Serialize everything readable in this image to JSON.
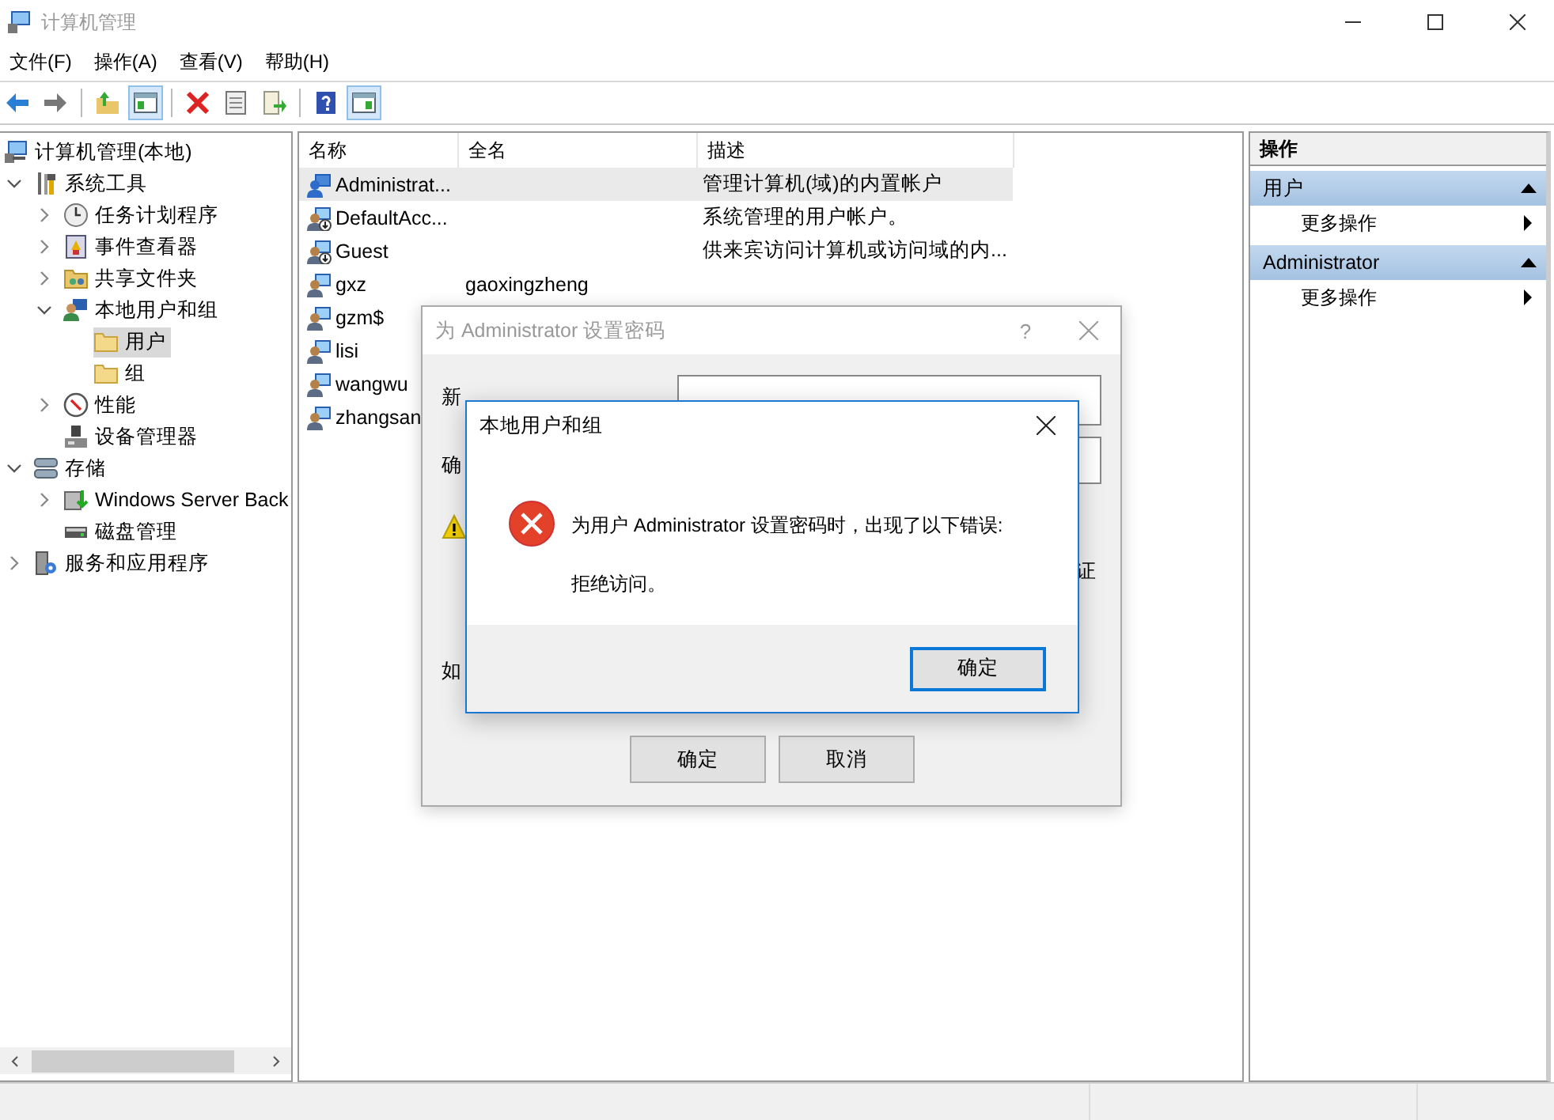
{
  "window": {
    "title": "计算机管理"
  },
  "menu": [
    "文件(F)",
    "操作(A)",
    "查看(V)",
    "帮助(H)"
  ],
  "toolbar": [
    [
      {
        "kind": "back",
        "selected": false
      },
      {
        "kind": "forward",
        "selected": false
      }
    ],
    [
      {
        "kind": "up",
        "selected": false
      },
      {
        "kind": "tree-pane",
        "selected": true
      }
    ],
    [
      {
        "kind": "delete",
        "selected": false
      },
      {
        "kind": "properties",
        "selected": false
      },
      {
        "kind": "export",
        "selected": false
      }
    ],
    [
      {
        "kind": "help",
        "selected": false
      },
      {
        "kind": "action-pane",
        "selected": true
      }
    ]
  ],
  "tree": {
    "label": "计算机管理(本地)",
    "kind": "computer",
    "selected": false,
    "children": [
      {
        "label": "系统工具",
        "kind": "tools",
        "expanded": true,
        "selected": false,
        "children": [
          {
            "label": "任务计划程序",
            "kind": "clock",
            "expanded": false,
            "selected": false
          },
          {
            "label": "事件查看器",
            "kind": "event",
            "expanded": false,
            "selected": false
          },
          {
            "label": "共享文件夹",
            "kind": "share",
            "expanded": false,
            "selected": false
          },
          {
            "label": "本地用户和组",
            "kind": "users",
            "expanded": true,
            "selected": false,
            "children": [
              {
                "label": "用户",
                "kind": "folder",
                "selected": true
              },
              {
                "label": "组",
                "kind": "folder",
                "selected": false
              }
            ]
          },
          {
            "label": "性能",
            "kind": "perf",
            "expanded": false,
            "selected": false
          },
          {
            "label": "设备管理器",
            "kind": "device",
            "selected": false
          }
        ]
      },
      {
        "label": "存储",
        "kind": "storage",
        "expanded": true,
        "selected": false,
        "children": [
          {
            "label": "Windows Server Back",
            "kind": "backup",
            "expanded": false,
            "selected": false
          },
          {
            "label": "磁盘管理",
            "kind": "disk",
            "selected": false
          }
        ]
      },
      {
        "label": "服务和应用程序",
        "kind": "services",
        "expanded": false,
        "selected": false
      }
    ]
  },
  "table": {
    "columns": [
      "名称",
      "全名",
      "描述"
    ],
    "rows": [
      {
        "name": "Administrat...",
        "full_name": "",
        "description": "管理计算机(域)的内置帐户",
        "kind": "user",
        "selected": true
      },
      {
        "name": "DefaultAcc...",
        "full_name": "",
        "description": "系统管理的用户帐户。",
        "kind": "disabled-user",
        "selected": false
      },
      {
        "name": "Guest",
        "full_name": "",
        "description": "供来宾访问计算机或访问域的内...",
        "kind": "disabled-user",
        "selected": false
      },
      {
        "name": "gxz",
        "full_name": "gaoxingzheng",
        "description": "",
        "kind": "user",
        "selected": false
      },
      {
        "name": "gzm$",
        "full_name": "",
        "description": "",
        "kind": "user",
        "selected": false
      },
      {
        "name": "lisi",
        "full_name": "",
        "description": "",
        "kind": "user",
        "selected": false
      },
      {
        "name": "wangwu",
        "full_name": "",
        "description": "",
        "kind": "user",
        "selected": false
      },
      {
        "name": "zhangsan",
        "full_name": "",
        "description": "",
        "kind": "user",
        "selected": false
      }
    ]
  },
  "actions": {
    "title": "操作",
    "sections": [
      {
        "title": "用户",
        "expanded": true,
        "items": [
          "更多操作"
        ]
      },
      {
        "title": "Administrator",
        "expanded": true,
        "items": [
          "更多操作"
        ]
      }
    ]
  },
  "password_dialog": {
    "title": "为 Administrator 设置密码",
    "help": "?",
    "labels": [
      "新",
      "确"
    ],
    "fragments": [
      "证",
      "如"
    ],
    "buttons": [
      "确定",
      "取消"
    ]
  },
  "error_dialog": {
    "title": "本地用户和组",
    "message": "为用户 Administrator 设置密码时，出现了以下错误:",
    "detail": "拒绝访问。",
    "button": "确定"
  }
}
